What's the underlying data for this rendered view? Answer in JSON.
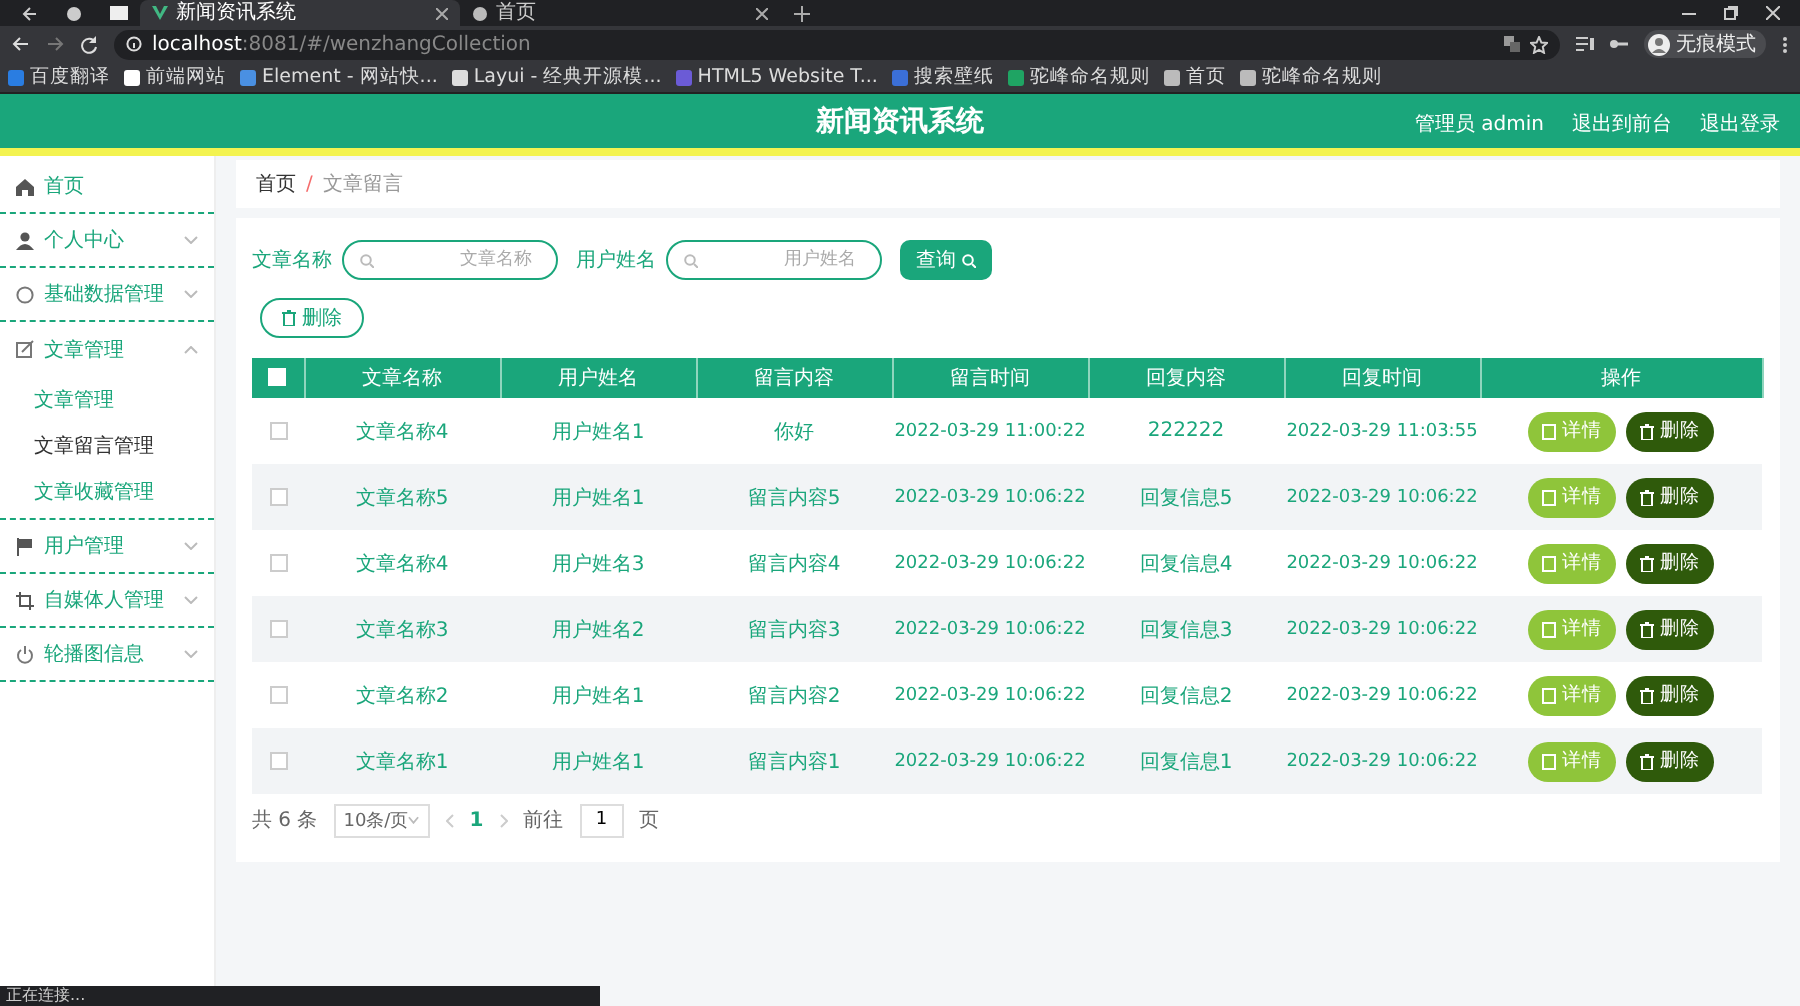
{
  "browser": {
    "tabs": [
      {
        "title": "新闻资讯系统",
        "selected": true
      },
      {
        "title": "首页",
        "selected": false
      }
    ],
    "address": {
      "host": "localhost",
      "path": ":8081/#/wenzhangCollection"
    },
    "bookmarks": [
      "百度翻译",
      "前端网站",
      "Element - 网站快...",
      "Layui - 经典开源模...",
      "HTML5 Website T...",
      "搜索壁纸",
      "驼峰命名规则",
      "首页",
      "驼峰命名规则"
    ],
    "profile": "无痕模式"
  },
  "header": {
    "title": "新闻资讯系统",
    "links": [
      "管理员 admin",
      "退出到前台",
      "退出登录"
    ]
  },
  "sidebar": {
    "items": [
      {
        "label": "首页"
      },
      {
        "label": "个人中心",
        "expanded": false
      },
      {
        "label": "基础数据管理",
        "expanded": false
      },
      {
        "label": "文章管理",
        "expanded": true,
        "children": [
          {
            "label": "文章管理",
            "selected": false
          },
          {
            "label": "文章留言管理",
            "selected": true
          },
          {
            "label": "文章收藏管理",
            "selected": false
          }
        ]
      },
      {
        "label": "用户管理",
        "expanded": false
      },
      {
        "label": "自媒体人管理",
        "expanded": false
      },
      {
        "label": "轮播图信息",
        "expanded": false
      }
    ]
  },
  "breadcrumb": {
    "items": [
      "首页",
      "文章留言"
    ],
    "separator": "/"
  },
  "search": {
    "fields": [
      {
        "label": "文章名称",
        "placeholder": "文章名称"
      },
      {
        "label": "用户姓名",
        "placeholder": "用户姓名"
      }
    ],
    "button": "查询"
  },
  "delete_button": "删除",
  "table": {
    "select_all_checked": false,
    "columns": [
      "文章名称",
      "用户姓名",
      "留言内容",
      "留言时间",
      "回复内容",
      "回复时间",
      "操作"
    ],
    "rows": [
      {
        "checked": false,
        "cells": [
          "文章名称4",
          "用户姓名1",
          "你好",
          "2022-03-29 11:00:22",
          "222222",
          "2022-03-29 11:03:55"
        ],
        "actions": [
          "详情",
          "删除"
        ]
      },
      {
        "checked": false,
        "cells": [
          "文章名称5",
          "用户姓名1",
          "留言内容5",
          "2022-03-29 10:06:22",
          "回复信息5",
          "2022-03-29 10:06:22"
        ],
        "actions": [
          "详情",
          "删除"
        ]
      },
      {
        "checked": false,
        "cells": [
          "文章名称4",
          "用户姓名3",
          "留言内容4",
          "2022-03-29 10:06:22",
          "回复信息4",
          "2022-03-29 10:06:22"
        ],
        "actions": [
          "详情",
          "删除"
        ]
      },
      {
        "checked": false,
        "cells": [
          "文章名称3",
          "用户姓名2",
          "留言内容3",
          "2022-03-29 10:06:22",
          "回复信息3",
          "2022-03-29 10:06:22"
        ],
        "actions": [
          "详情",
          "删除"
        ]
      },
      {
        "checked": false,
        "cells": [
          "文章名称2",
          "用户姓名1",
          "留言内容2",
          "2022-03-29 10:06:22",
          "回复信息2",
          "2022-03-29 10:06:22"
        ],
        "actions": [
          "详情",
          "删除"
        ]
      },
      {
        "checked": false,
        "cells": [
          "文章名称1",
          "用户姓名1",
          "留言内容1",
          "2022-03-29 10:06:22",
          "回复信息1",
          "2022-03-29 10:06:22"
        ],
        "actions": [
          "详情",
          "删除"
        ]
      }
    ]
  },
  "pagination": {
    "total": "共 6 条",
    "page_size": "10条/页",
    "pages": [
      {
        "label": "1",
        "selected": true
      }
    ],
    "goto_label": "前往",
    "goto_value": "1",
    "goto_suffix": "页"
  },
  "status_bar": "正在连接..."
}
